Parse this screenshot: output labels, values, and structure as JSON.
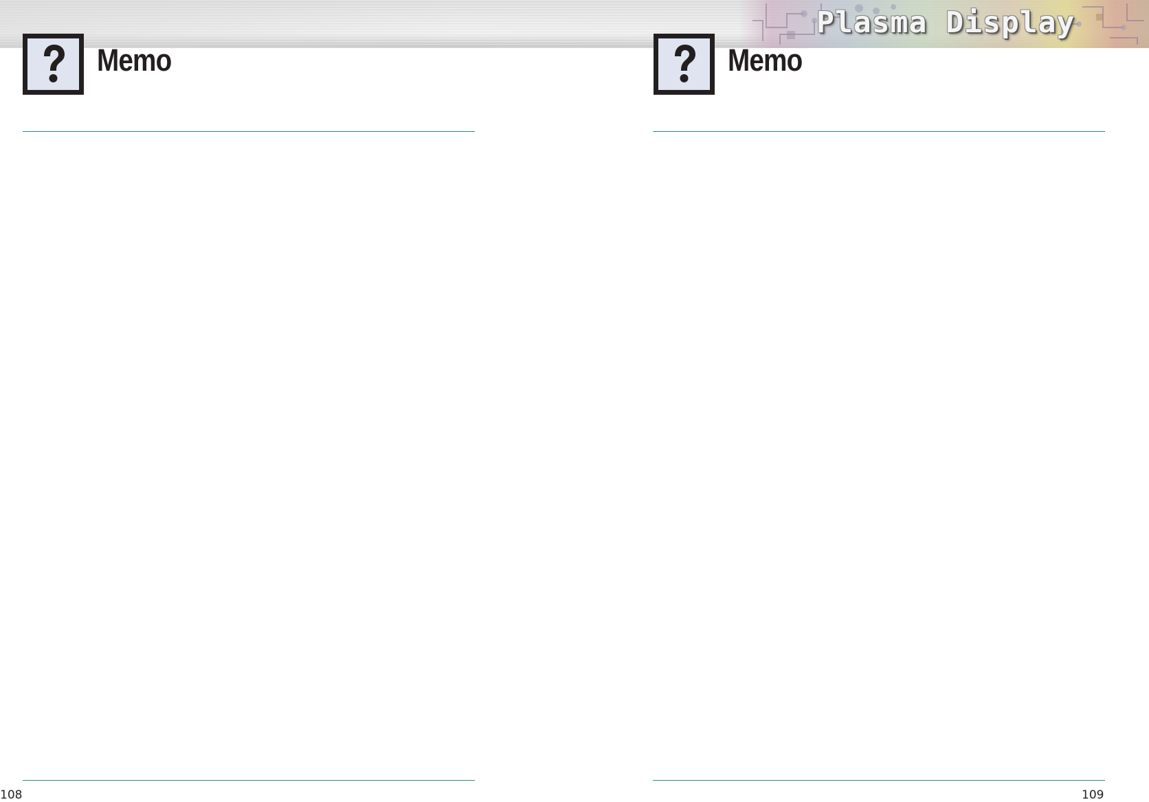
{
  "header": {
    "title": "Plasma Display"
  },
  "left_page": {
    "heading": "Memo",
    "icon": "question-mark-icon",
    "page_number": "108"
  },
  "right_page": {
    "heading": "Memo",
    "icon": "question-mark-icon",
    "page_number": "109"
  },
  "colors": {
    "rule": "#2a8a7a",
    "text": "#231f20",
    "icon_background": "#dfe4f0"
  }
}
